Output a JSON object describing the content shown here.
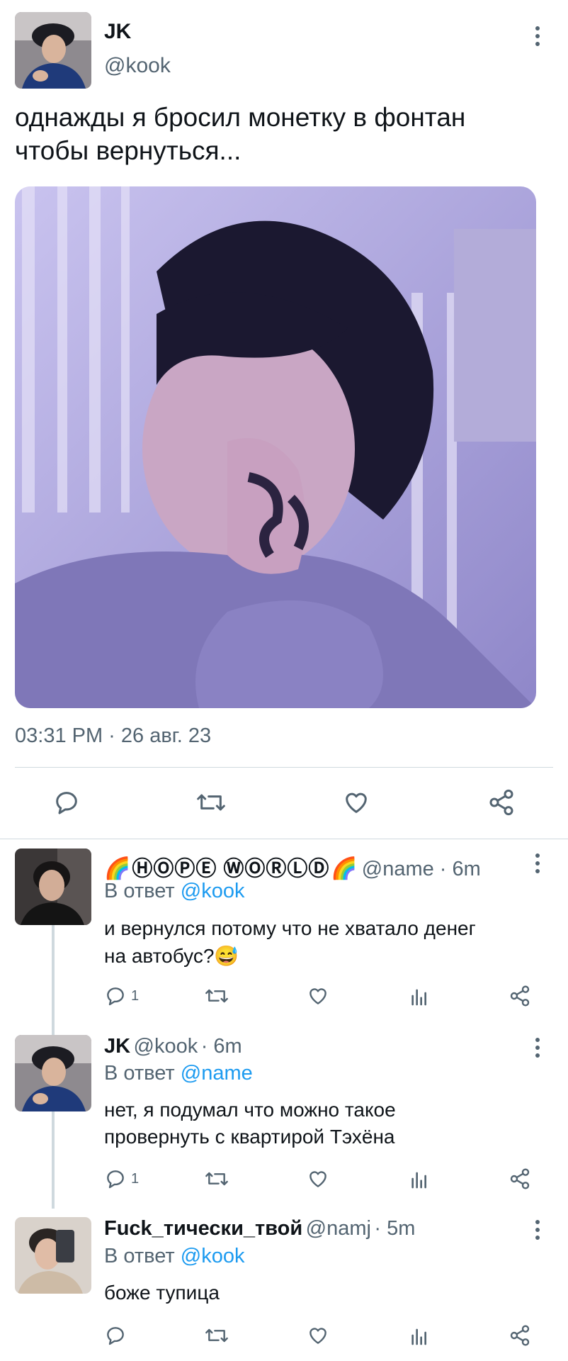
{
  "main_tweet": {
    "author_name": "JK",
    "handle": "@kook",
    "text_line1": "однажды я бросил монетку в фонтан",
    "text_line2": "чтобы вернуться...",
    "timestamp": "03:31 PM · 26 авг. 23"
  },
  "replies": [
    {
      "name_prefix_emoji": "🌈",
      "name": "ⒽⓄⓅⒺ ⓌⓄⓇⓁⒹ",
      "name_suffix_emoji": "🌈",
      "handle": "@name",
      "time": "· 6m",
      "reply_to_label": "В ответ",
      "reply_to": "@kook",
      "text_line1": "и вернулся потому что не хватало денег",
      "text_line2": "на автобус?",
      "text_emoji": "😅",
      "reply_count": "1"
    },
    {
      "name": "JK",
      "handle": "@kook",
      "time": "· 6m",
      "reply_to_label": "В ответ",
      "reply_to": "@name",
      "text_line1": "нет, я подумал что можно такое",
      "text_line2": "провернуть с квартирой Тэхёна",
      "reply_count": "1"
    },
    {
      "name": "Fuck_тически_твой",
      "handle": "@namj",
      "time": "· 5m",
      "reply_to_label": "В ответ",
      "reply_to": "@kook",
      "text_line1": "боже тупица"
    }
  ],
  "colors": {
    "link": "#1d9bf0",
    "muted": "#536471",
    "photo_tint": "#9a92d4"
  },
  "icons": [
    "more-vertical-icon",
    "reply-icon",
    "retweet-icon",
    "like-icon",
    "views-icon",
    "share-icon"
  ]
}
